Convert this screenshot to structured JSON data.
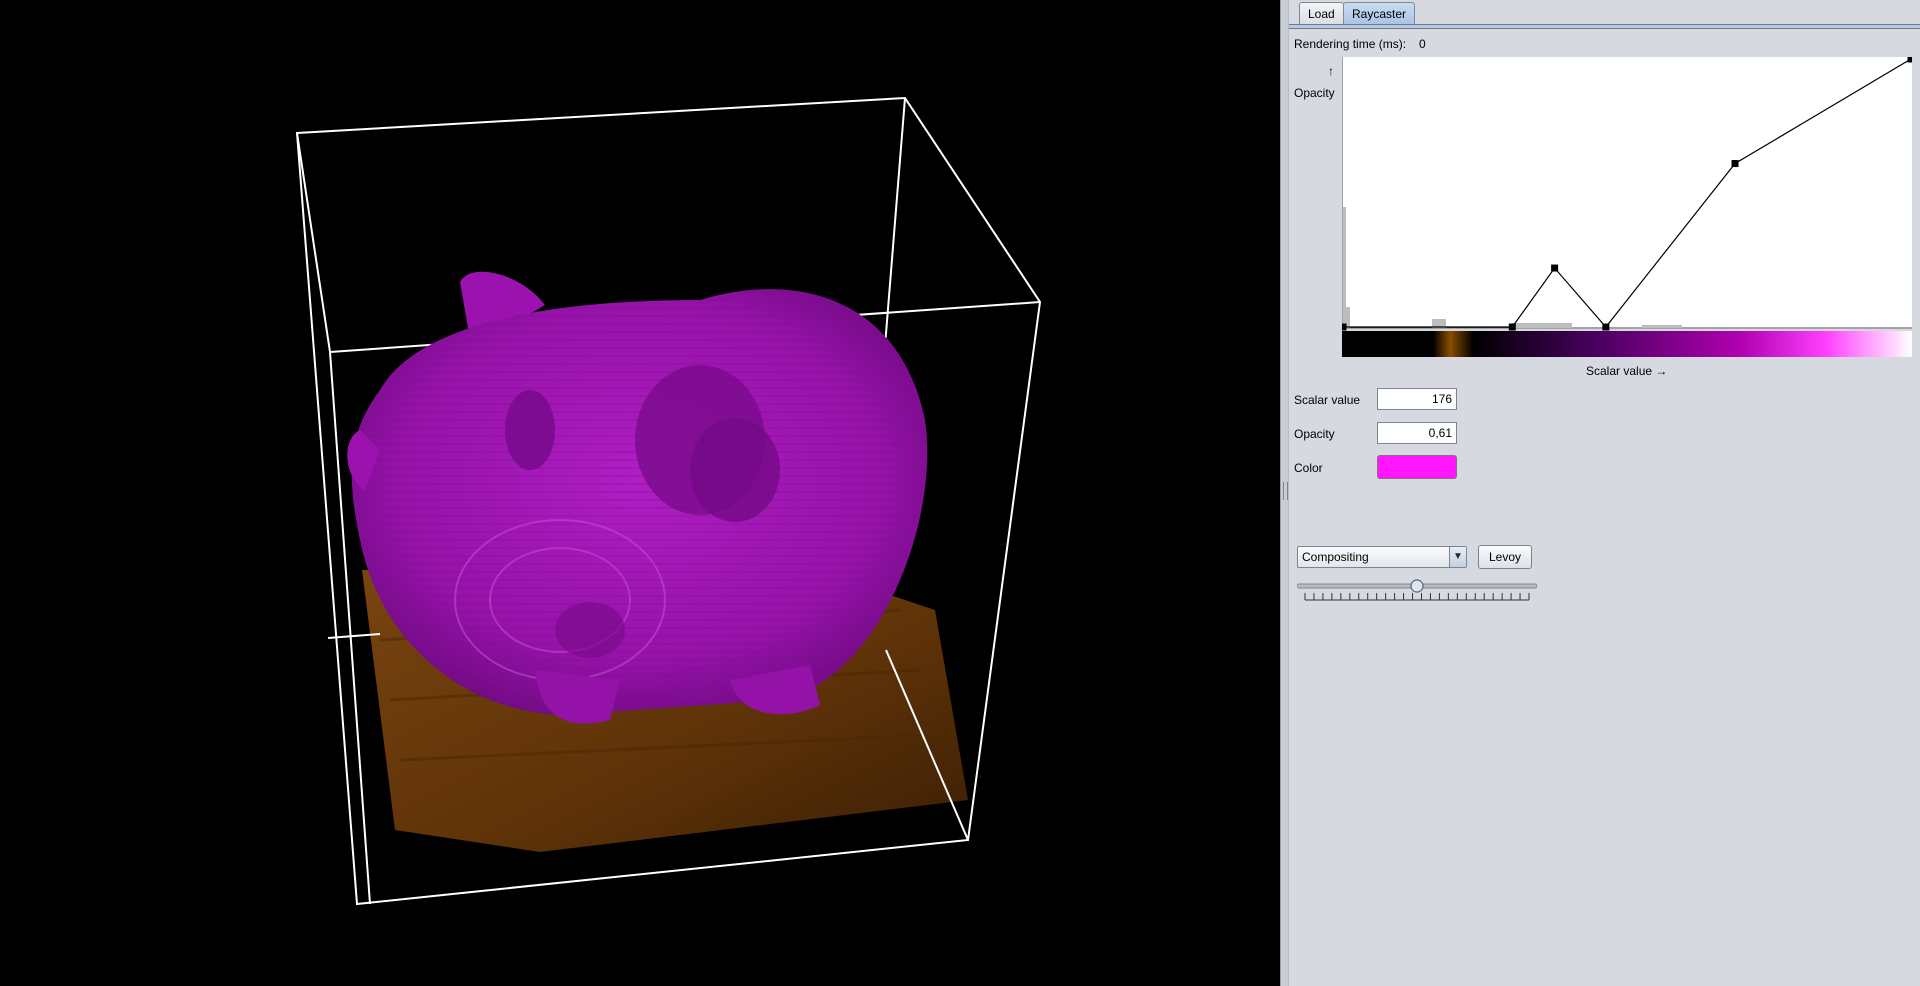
{
  "tabs": [
    {
      "label": "Load",
      "active": false
    },
    {
      "label": "Raycaster",
      "active": true
    }
  ],
  "rendering_time": {
    "label": "Rendering time (ms):",
    "value": "0"
  },
  "transfer_function": {
    "y_axis_label": "Opacity",
    "x_axis_label": "Scalar value",
    "control_points": [
      {
        "scalar": 0,
        "opacity": 0.0
      },
      {
        "scalar": 76,
        "opacity": 0.0
      },
      {
        "scalar": 95,
        "opacity": 0.22
      },
      {
        "scalar": 118,
        "opacity": 0.0
      },
      {
        "scalar": 176,
        "opacity": 0.61
      },
      {
        "scalar": 255,
        "opacity": 1.0
      }
    ],
    "scalar_range": [
      0,
      255
    ],
    "opacity_range": [
      0,
      1
    ],
    "colormap": [
      "#000000",
      "#000000",
      "#8a4d00",
      "#000000",
      "#4a0060",
      "#b000b0",
      "#ff40ff",
      "#ffffff"
    ]
  },
  "selected_point": {
    "scalar_label": "Scalar value",
    "scalar_value": "176",
    "opacity_label": "Opacity",
    "opacity_value": "0,61",
    "color_label": "Color",
    "color": "#ff17ff"
  },
  "render_mode": {
    "selected": "Compositing",
    "button_label": "Levoy"
  },
  "slider": {
    "level": 0.5,
    "ticks": 26
  },
  "volume": {
    "object_color": "#a014b4",
    "base_color": "#6e3c0a",
    "box_color": "#ffffff"
  }
}
